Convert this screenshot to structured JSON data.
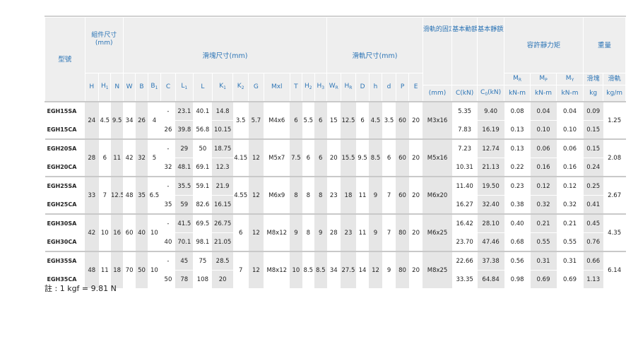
{
  "header": {
    "model": "型號",
    "assembly": "組件尺寸\n(mm)",
    "block": "滑塊尺寸(mm)",
    "rail": "滑軌尺寸(mm)",
    "bolt": "滑軌的固定螺栓尺寸",
    "dyn": "基本動額定負荷",
    "stat": "基本靜額定負荷",
    "moment": "容許靜力矩",
    "weight": "重量",
    "weight_block": "滑塊",
    "weight_rail": "滑軌",
    "cols": {
      "H": "H",
      "H1": "H",
      "N": "N",
      "W": "W",
      "B": "B",
      "B1": "B",
      "C": "C",
      "L1": "L",
      "L": "L",
      "K1": "K",
      "K2": "K",
      "G": "G",
      "Mxl": "Mxl",
      "T": "T",
      "H2": "H",
      "H3": "H",
      "WR": "W",
      "HR": "H",
      "D": "D",
      "h": "h",
      "d": "d",
      "P": "P",
      "E": "E",
      "MR": "M",
      "MP": "M",
      "MY": "M"
    },
    "subs": {
      "H1": "1",
      "B1": "1",
      "L1": "1",
      "K1": "1",
      "K2": "2",
      "H2": "2",
      "H3": "3",
      "WR": "R",
      "HR": "R",
      "C0": "0",
      "MR": "R",
      "MP": "P",
      "MY": "Y"
    },
    "units": {
      "bolt": "(mm)",
      "dyn": "C(kN)",
      "stat_prefix": "C",
      "stat_suffix": "(kN)",
      "mr": "kN-m",
      "mp": "kN-m",
      "my": "kN-m",
      "wb": "kg",
      "wr": "kg/m"
    }
  },
  "groups": [
    {
      "H": "24",
      "H1": "4.5",
      "N": "9.5",
      "W": "34",
      "B": "26",
      "B1": "4",
      "K2": "3.5",
      "G": "5.7",
      "Mxl": "M4x6",
      "T": "6",
      "H2": "5.5",
      "H3": "6",
      "WR": "15",
      "HR": "12.5",
      "D": "6",
      "h": "4.5",
      "d": "3.5",
      "P": "60",
      "E": "20",
      "bolt": "M3x16",
      "rail_weight": "1.25",
      "rows": [
        {
          "model": "EGH15SA",
          "C": "-",
          "L1": "23.1",
          "L": "40.1",
          "K1": "14.8",
          "dyn": "5.35",
          "stat": "9.40",
          "MR": "0.08",
          "MP": "0.04",
          "MY": "0.04",
          "wb": "0.09"
        },
        {
          "model": "EGH15CA",
          "C": "26",
          "L1": "39.8",
          "L": "56.8",
          "K1": "10.15",
          "dyn": "7.83",
          "stat": "16.19",
          "MR": "0.13",
          "MP": "0.10",
          "MY": "0.10",
          "wb": "0.15"
        }
      ]
    },
    {
      "H": "28",
      "H1": "6",
      "N": "11",
      "W": "42",
      "B": "32",
      "B1": "5",
      "K2": "4.15",
      "G": "12",
      "Mxl": "M5x7",
      "T": "7.5",
      "H2": "6",
      "H3": "6",
      "WR": "20",
      "HR": "15.5",
      "D": "9.5",
      "h": "8.5",
      "d": "6",
      "P": "60",
      "E": "20",
      "bolt": "M5x16",
      "rail_weight": "2.08",
      "rows": [
        {
          "model": "EGH20SA",
          "C": "-",
          "L1": "29",
          "L": "50",
          "K1": "18.75",
          "dyn": "7.23",
          "stat": "12.74",
          "MR": "0.13",
          "MP": "0.06",
          "MY": "0.06",
          "wb": "0.15"
        },
        {
          "model": "EGH20CA",
          "C": "32",
          "L1": "48.1",
          "L": "69.1",
          "K1": "12.3",
          "dyn": "10.31",
          "stat": "21.13",
          "MR": "0.22",
          "MP": "0.16",
          "MY": "0.16",
          "wb": "0.24"
        }
      ]
    },
    {
      "H": "33",
      "H1": "7",
      "N": "12.5",
      "W": "48",
      "B": "35",
      "B1": "6.5",
      "K2": "4.55",
      "G": "12",
      "Mxl": "M6x9",
      "T": "8",
      "H2": "8",
      "H3": "8",
      "WR": "23",
      "HR": "18",
      "D": "11",
      "h": "9",
      "d": "7",
      "P": "60",
      "E": "20",
      "bolt": "M6x20",
      "rail_weight": "2.67",
      "rows": [
        {
          "model": "EGH25SA",
          "C": "-",
          "L1": "35.5",
          "L": "59.1",
          "K1": "21.9",
          "dyn": "11.40",
          "stat": "19.50",
          "MR": "0.23",
          "MP": "0.12",
          "MY": "0.12",
          "wb": "0.25"
        },
        {
          "model": "EGH25CA",
          "C": "35",
          "L1": "59",
          "L": "82.6",
          "K1": "16.15",
          "dyn": "16.27",
          "stat": "32.40",
          "MR": "0.38",
          "MP": "0.32",
          "MY": "0.32",
          "wb": "0.41"
        }
      ]
    },
    {
      "H": "42",
      "H1": "10",
      "N": "16",
      "W": "60",
      "B": "40",
      "B1": "10",
      "K2": "6",
      "G": "12",
      "Mxl": "M8x12",
      "T": "9",
      "H2": "8",
      "H3": "9",
      "WR": "28",
      "HR": "23",
      "D": "11",
      "h": "9",
      "d": "7",
      "P": "80",
      "E": "20",
      "bolt": "M6x25",
      "rail_weight": "4.35",
      "rows": [
        {
          "model": "EGH30SA",
          "C": "-",
          "L1": "41.5",
          "L": "69.5",
          "K1": "26.75",
          "dyn": "16.42",
          "stat": "28.10",
          "MR": "0.40",
          "MP": "0.21",
          "MY": "0.21",
          "wb": "0.45"
        },
        {
          "model": "EGH30CA",
          "C": "40",
          "L1": "70.1",
          "L": "98.1",
          "K1": "21.05",
          "dyn": "23.70",
          "stat": "47.46",
          "MR": "0.68",
          "MP": "0.55",
          "MY": "0.55",
          "wb": "0.76"
        }
      ]
    },
    {
      "H": "48",
      "H1": "11",
      "N": "18",
      "W": "70",
      "B": "50",
      "B1": "10",
      "K2": "7",
      "G": "12",
      "Mxl": "M8x12",
      "T": "10",
      "H2": "8.5",
      "H3": "8.5",
      "WR": "34",
      "HR": "27.5",
      "D": "14",
      "h": "12",
      "d": "9",
      "P": "80",
      "E": "20",
      "bolt": "M8x25",
      "rail_weight": "6.14",
      "rows": [
        {
          "model": "EGH35SA",
          "C": "-",
          "L1": "45",
          "L": "75",
          "K1": "28.5",
          "dyn": "22.66",
          "stat": "37.38",
          "MR": "0.56",
          "MP": "0.31",
          "MY": "0.31",
          "wb": "0.66"
        },
        {
          "model": "EGH35CA",
          "C": "50",
          "L1": "78",
          "L": "108",
          "K1": "20",
          "dyn": "33.35",
          "stat": "64.84",
          "MR": "0.98",
          "MP": "0.69",
          "MY": "0.69",
          "wb": "1.13"
        }
      ]
    }
  ],
  "note": "註 : 1 kgf = 9.81 N"
}
